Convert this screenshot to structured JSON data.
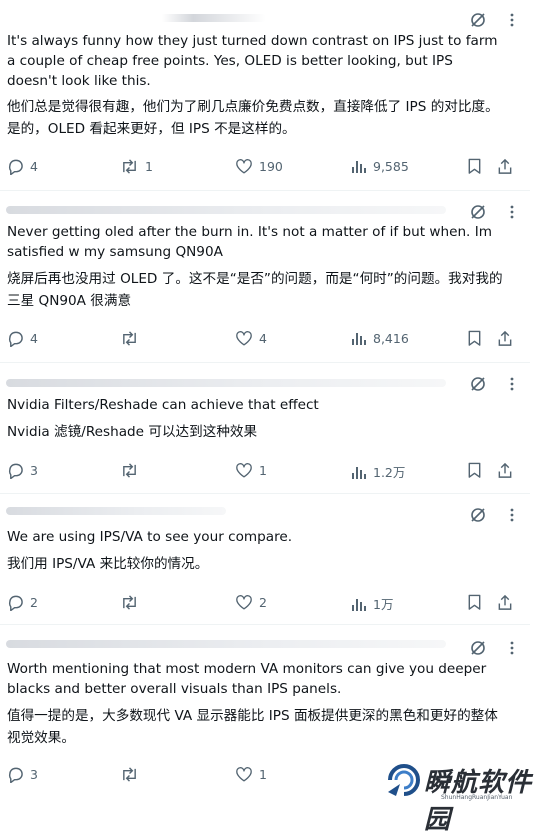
{
  "tweets": [
    {
      "en": "It's always funny how they just turned down contrast on IPS just to farm a couple of cheap free points. Yes, OLED is better looking, but IPS doesn't look like this.",
      "zh": "他们总是觉得很有趣，他们为了刷几点廉价免费点数，直接降低了 IPS 的对比度。是的，OLED 看起来更好，但 IPS 不是这样的。",
      "replies": "4",
      "reposts": "1",
      "likes": "190",
      "views": "9,585"
    },
    {
      "en": "Never getting oled after the burn in. It's not a matter of if but when. Im satisfied w my samsung QN90A",
      "zh": "烧屏后再也没用过 OLED 了。这不是“是否”的问题，而是“何时”的问题。我对我的三星 QN90A 很满意",
      "replies": "4",
      "reposts": "",
      "likes": "4",
      "views": "8,416"
    },
    {
      "en": "Nvidia Filters/Reshade can achieve that effect",
      "zh": "Nvidia 滤镜/Reshade 可以达到这种效果",
      "replies": "3",
      "reposts": "",
      "likes": "1",
      "views": "1.2万"
    },
    {
      "en": "We are using IPS/VA to see your compare.",
      "zh": "我们用 IPS/VA 来比较你的情况。",
      "replies": "2",
      "reposts": "",
      "likes": "2",
      "views": "1万"
    },
    {
      "en": "Worth mentioning that most modern VA monitors can give you deeper blacks and better overall visuals than IPS panels.",
      "zh": "值得一提的是，大多数现代 VA 显示器能比 IPS 面板提供更深的黑色和更好的整体视觉效果。",
      "replies": "3",
      "reposts": "",
      "likes": "1",
      "views": ""
    }
  ],
  "watermark": {
    "title": "瞬航软件园",
    "subtitle": "ShunHangRuanJianYuan"
  },
  "icons": [
    "grok-icon",
    "more-icon",
    "reply-icon",
    "repost-icon",
    "like-icon",
    "views-icon",
    "bookmark-icon",
    "share-icon"
  ],
  "colors": {
    "text": "#0f1419",
    "muted": "#536471",
    "divider": "#eff3f4"
  }
}
